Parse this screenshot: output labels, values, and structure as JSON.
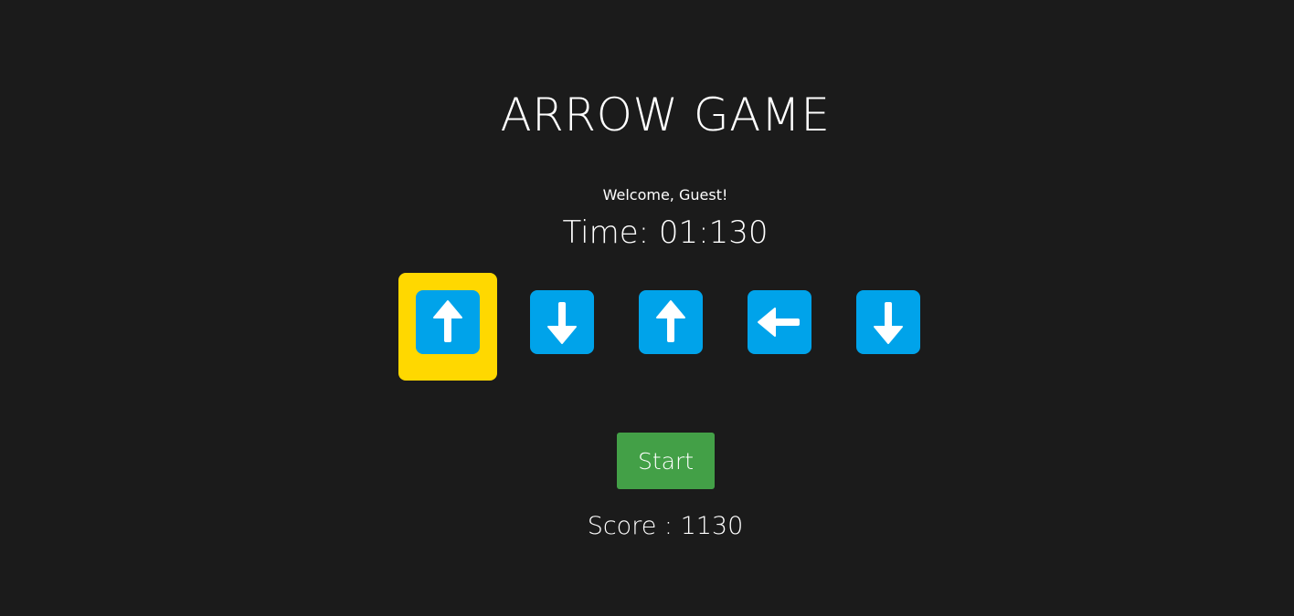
{
  "game": {
    "title": "ARROW GAME",
    "welcome_text": "Welcome, Guest!",
    "timer_text": "Time: 01:130",
    "start_label": "Start",
    "score_text": "Score : 1130"
  },
  "sequence": [
    {
      "direction": "up",
      "active": true
    },
    {
      "direction": "down",
      "active": false
    },
    {
      "direction": "up",
      "active": false
    },
    {
      "direction": "left",
      "active": false
    },
    {
      "direction": "down",
      "active": false
    }
  ],
  "colors": {
    "background": "#1b1b1b",
    "tile": "#00a3ea",
    "active_highlight": "#ffd800",
    "start_button": "#43a047",
    "text": "#ffffff"
  }
}
